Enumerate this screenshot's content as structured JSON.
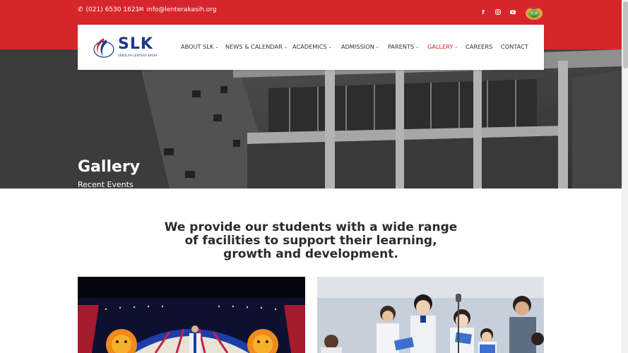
{
  "topbar": {
    "phone": "(021) 6530 1621",
    "email": "info@lenterakasih.org",
    "social": [
      "facebook-icon",
      "instagram-icon",
      "youtube-icon"
    ],
    "color": "#d7262b"
  },
  "logo": {
    "text": "SLK",
    "subtitle": "SEKOLAH LENTERA KASIH"
  },
  "nav": {
    "items": [
      {
        "label": "ABOUT SLK",
        "dropdown": true
      },
      {
        "label": "NEWS & CALENDAR",
        "dropdown": true
      },
      {
        "label": "ACADEMICS",
        "dropdown": true
      },
      {
        "label": "ADMISSION",
        "dropdown": true
      },
      {
        "label": "PARENTS",
        "dropdown": true
      },
      {
        "label": "GALLERY",
        "dropdown": true,
        "active": true
      },
      {
        "label": "CAREERS",
        "dropdown": false
      },
      {
        "label": "CONTACT",
        "dropdown": false
      }
    ],
    "active_color": "#d7262b"
  },
  "hero": {
    "title": "Gallery",
    "subtitle": "Recent Events"
  },
  "intro": {
    "text": "We provide our students with a wide range of facilities to support their learning, growth and development."
  },
  "gallery": {
    "images": [
      "stage-performance-photo",
      "students-singing-photo"
    ]
  }
}
